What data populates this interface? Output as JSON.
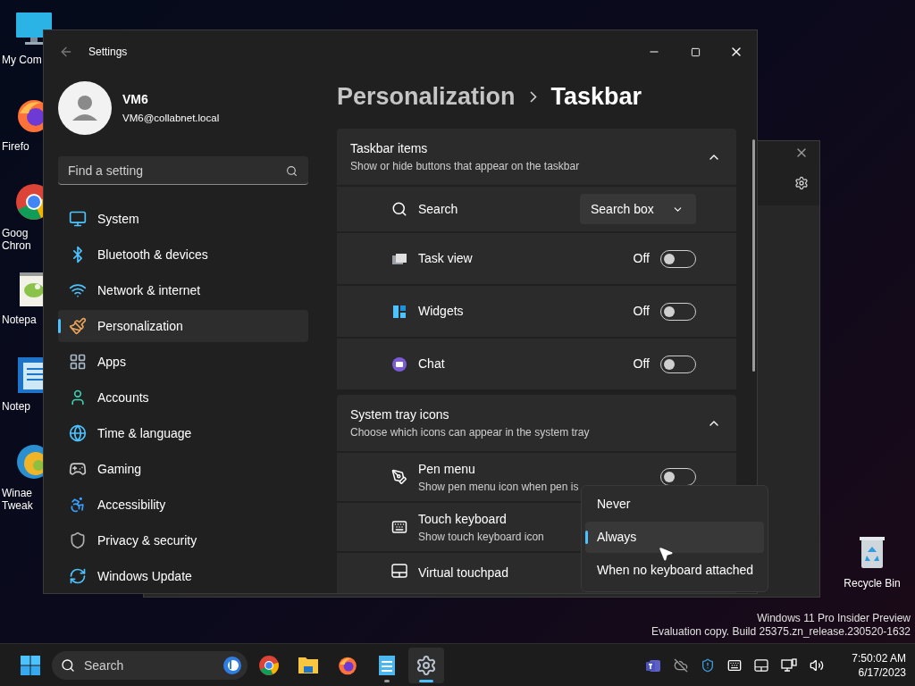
{
  "desktop_icons": [
    {
      "kind": "monitor",
      "lines": [
        "My Com"
      ]
    },
    {
      "kind": "firefox",
      "lines": [
        "Firefo"
      ]
    },
    {
      "kind": "chrome",
      "lines": [
        "Goog",
        "Chron"
      ]
    },
    {
      "kind": "notepadpp",
      "lines": [
        "Notepa"
      ]
    },
    {
      "kind": "notepad",
      "lines": [
        "Notep"
      ]
    },
    {
      "kind": "winaero",
      "lines": [
        "Winae",
        "Tweak"
      ]
    }
  ],
  "recycle_bin": {
    "label": "Recycle Bin"
  },
  "settings": {
    "title": "Settings",
    "user": {
      "name": "VM6",
      "email": "VM6@collabnet.local"
    },
    "search": {
      "placeholder": "Find a setting"
    },
    "nav": [
      {
        "kind": "system",
        "label": "System",
        "selected": false
      },
      {
        "kind": "bluetooth",
        "label": "Bluetooth & devices",
        "selected": false
      },
      {
        "kind": "network",
        "label": "Network & internet",
        "selected": false
      },
      {
        "kind": "personalization",
        "label": "Personalization",
        "selected": true
      },
      {
        "kind": "apps",
        "label": "Apps",
        "selected": false
      },
      {
        "kind": "accounts",
        "label": "Accounts",
        "selected": false
      },
      {
        "kind": "time",
        "label": "Time & language",
        "selected": false
      },
      {
        "kind": "gaming",
        "label": "Gaming",
        "selected": false
      },
      {
        "kind": "accessibility",
        "label": "Accessibility",
        "selected": false
      },
      {
        "kind": "privacy",
        "label": "Privacy & security",
        "selected": false
      },
      {
        "kind": "update",
        "label": "Windows Update",
        "selected": false
      }
    ],
    "breadcrumb": [
      "Personalization",
      "Taskbar"
    ],
    "sections": [
      {
        "title": "Taskbar items",
        "subtitle": "Show or hide buttons that appear on the taskbar",
        "expanded": true,
        "rows": [
          {
            "kind": "dropdown",
            "label": "Search",
            "value": "Search box"
          },
          {
            "kind": "toggle",
            "label": "Task view",
            "state_label": "Off",
            "on": false
          },
          {
            "kind": "toggle",
            "label": "Widgets",
            "state_label": "Off",
            "on": false
          },
          {
            "kind": "toggle",
            "label": "Chat",
            "state_label": "Off",
            "on": false
          }
        ]
      },
      {
        "title": "System tray icons",
        "subtitle": "Choose which icons can appear in the system tray",
        "expanded": true,
        "rows": [
          {
            "kind": "toggle",
            "label": "Pen menu",
            "subtitle": "Show pen menu icon when pen is",
            "on": false
          },
          {
            "kind": "text",
            "label": "Touch keyboard",
            "subtitle": "Show touch keyboard icon"
          },
          {
            "kind": "text",
            "label": "Virtual touchpad"
          }
        ]
      }
    ]
  },
  "menu": {
    "options": [
      {
        "label": "Never",
        "selected": false
      },
      {
        "label": "Always",
        "selected": true
      },
      {
        "label": "When no keyboard attached",
        "selected": false
      }
    ]
  },
  "watermark": [
    "Windows 11 Pro Insider Preview",
    "Evaluation copy. Build 25375.zn_release.230520-1632"
  ],
  "taskbar": {
    "search_placeholder": "Search",
    "apps": [
      {
        "kind": "chrome",
        "running": false,
        "selected": false
      },
      {
        "kind": "explorer",
        "running": false,
        "selected": false
      },
      {
        "kind": "firefox",
        "running": false,
        "selected": false
      },
      {
        "kind": "notepad",
        "running": true,
        "selected": false
      },
      {
        "kind": "settings",
        "running": true,
        "selected": true
      }
    ],
    "tray": [
      {
        "kind": "teams"
      },
      {
        "kind": "onedrive"
      },
      {
        "kind": "defender"
      },
      {
        "kind": "keyboard"
      },
      {
        "kind": "touchpad"
      },
      {
        "kind": "network"
      },
      {
        "kind": "volume"
      }
    ],
    "time": "7:50:02 AM",
    "date": "6/17/2023"
  }
}
